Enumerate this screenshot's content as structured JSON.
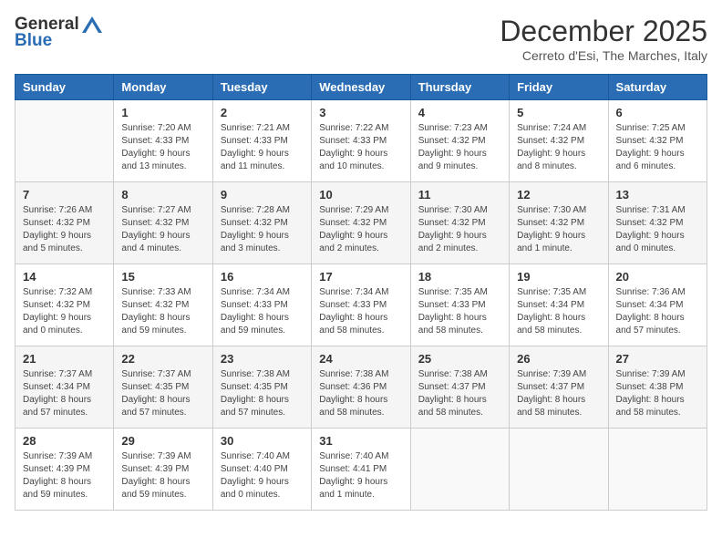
{
  "logo": {
    "general": "General",
    "blue": "Blue"
  },
  "header": {
    "month": "December 2025",
    "location": "Cerreto d'Esi, The Marches, Italy"
  },
  "days_of_week": [
    "Sunday",
    "Monday",
    "Tuesday",
    "Wednesday",
    "Thursday",
    "Friday",
    "Saturday"
  ],
  "weeks": [
    [
      {
        "day": "",
        "info": ""
      },
      {
        "day": "1",
        "info": "Sunrise: 7:20 AM\nSunset: 4:33 PM\nDaylight: 9 hours\nand 13 minutes."
      },
      {
        "day": "2",
        "info": "Sunrise: 7:21 AM\nSunset: 4:33 PM\nDaylight: 9 hours\nand 11 minutes."
      },
      {
        "day": "3",
        "info": "Sunrise: 7:22 AM\nSunset: 4:33 PM\nDaylight: 9 hours\nand 10 minutes."
      },
      {
        "day": "4",
        "info": "Sunrise: 7:23 AM\nSunset: 4:32 PM\nDaylight: 9 hours\nand 9 minutes."
      },
      {
        "day": "5",
        "info": "Sunrise: 7:24 AM\nSunset: 4:32 PM\nDaylight: 9 hours\nand 8 minutes."
      },
      {
        "day": "6",
        "info": "Sunrise: 7:25 AM\nSunset: 4:32 PM\nDaylight: 9 hours\nand 6 minutes."
      }
    ],
    [
      {
        "day": "7",
        "info": "Sunrise: 7:26 AM\nSunset: 4:32 PM\nDaylight: 9 hours\nand 5 minutes."
      },
      {
        "day": "8",
        "info": "Sunrise: 7:27 AM\nSunset: 4:32 PM\nDaylight: 9 hours\nand 4 minutes."
      },
      {
        "day": "9",
        "info": "Sunrise: 7:28 AM\nSunset: 4:32 PM\nDaylight: 9 hours\nand 3 minutes."
      },
      {
        "day": "10",
        "info": "Sunrise: 7:29 AM\nSunset: 4:32 PM\nDaylight: 9 hours\nand 2 minutes."
      },
      {
        "day": "11",
        "info": "Sunrise: 7:30 AM\nSunset: 4:32 PM\nDaylight: 9 hours\nand 2 minutes."
      },
      {
        "day": "12",
        "info": "Sunrise: 7:30 AM\nSunset: 4:32 PM\nDaylight: 9 hours\nand 1 minute."
      },
      {
        "day": "13",
        "info": "Sunrise: 7:31 AM\nSunset: 4:32 PM\nDaylight: 9 hours\nand 0 minutes."
      }
    ],
    [
      {
        "day": "14",
        "info": "Sunrise: 7:32 AM\nSunset: 4:32 PM\nDaylight: 9 hours\nand 0 minutes."
      },
      {
        "day": "15",
        "info": "Sunrise: 7:33 AM\nSunset: 4:32 PM\nDaylight: 8 hours\nand 59 minutes."
      },
      {
        "day": "16",
        "info": "Sunrise: 7:34 AM\nSunset: 4:33 PM\nDaylight: 8 hours\nand 59 minutes."
      },
      {
        "day": "17",
        "info": "Sunrise: 7:34 AM\nSunset: 4:33 PM\nDaylight: 8 hours\nand 58 minutes."
      },
      {
        "day": "18",
        "info": "Sunrise: 7:35 AM\nSunset: 4:33 PM\nDaylight: 8 hours\nand 58 minutes."
      },
      {
        "day": "19",
        "info": "Sunrise: 7:35 AM\nSunset: 4:34 PM\nDaylight: 8 hours\nand 58 minutes."
      },
      {
        "day": "20",
        "info": "Sunrise: 7:36 AM\nSunset: 4:34 PM\nDaylight: 8 hours\nand 57 minutes."
      }
    ],
    [
      {
        "day": "21",
        "info": "Sunrise: 7:37 AM\nSunset: 4:34 PM\nDaylight: 8 hours\nand 57 minutes."
      },
      {
        "day": "22",
        "info": "Sunrise: 7:37 AM\nSunset: 4:35 PM\nDaylight: 8 hours\nand 57 minutes."
      },
      {
        "day": "23",
        "info": "Sunrise: 7:38 AM\nSunset: 4:35 PM\nDaylight: 8 hours\nand 57 minutes."
      },
      {
        "day": "24",
        "info": "Sunrise: 7:38 AM\nSunset: 4:36 PM\nDaylight: 8 hours\nand 58 minutes."
      },
      {
        "day": "25",
        "info": "Sunrise: 7:38 AM\nSunset: 4:37 PM\nDaylight: 8 hours\nand 58 minutes."
      },
      {
        "day": "26",
        "info": "Sunrise: 7:39 AM\nSunset: 4:37 PM\nDaylight: 8 hours\nand 58 minutes."
      },
      {
        "day": "27",
        "info": "Sunrise: 7:39 AM\nSunset: 4:38 PM\nDaylight: 8 hours\nand 58 minutes."
      }
    ],
    [
      {
        "day": "28",
        "info": "Sunrise: 7:39 AM\nSunset: 4:39 PM\nDaylight: 8 hours\nand 59 minutes."
      },
      {
        "day": "29",
        "info": "Sunrise: 7:39 AM\nSunset: 4:39 PM\nDaylight: 8 hours\nand 59 minutes."
      },
      {
        "day": "30",
        "info": "Sunrise: 7:40 AM\nSunset: 4:40 PM\nDaylight: 9 hours\nand 0 minutes."
      },
      {
        "day": "31",
        "info": "Sunrise: 7:40 AM\nSunset: 4:41 PM\nDaylight: 9 hours\nand 1 minute."
      },
      {
        "day": "",
        "info": ""
      },
      {
        "day": "",
        "info": ""
      },
      {
        "day": "",
        "info": ""
      }
    ]
  ]
}
